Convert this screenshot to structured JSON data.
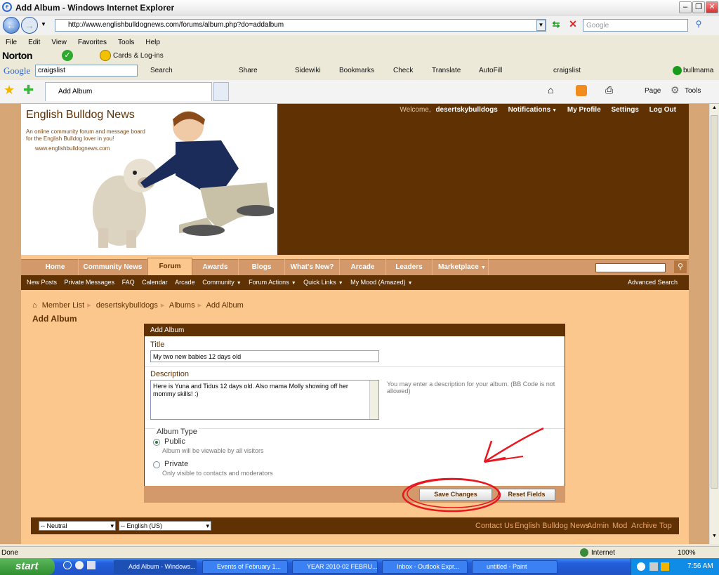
{
  "window": {
    "title": "Add Album - Windows Internet Explorer"
  },
  "browser": {
    "url": "http://www.englishbulldognews.com/forums/album.php?do=addalbum",
    "search_placeholder": "Google",
    "menu": [
      "File",
      "Edit",
      "View",
      "Favorites",
      "Tools",
      "Help"
    ],
    "norton": {
      "brand": "Norton",
      "cards_label": "Cards & Log-ins"
    },
    "google_toolbar": {
      "brand": "Google",
      "query": "craigslist",
      "items": [
        "Search",
        "Share",
        "Sidewiki",
        "Bookmarks",
        "Check",
        "Translate",
        "AutoFill",
        "craigslist"
      ],
      "user": "bullmama"
    },
    "tab_title": "Add Album",
    "cmd": {
      "page": "Page",
      "tools": "Tools"
    }
  },
  "site": {
    "title": "English Bulldog News",
    "tagline": "An online community forum and message board for the English Bulldog lover in you!",
    "url": "www.englishbulldognews.com",
    "welcome_label": "Welcome,",
    "username": "desertskybulldogs",
    "top_links": [
      "Notifications",
      "My Profile",
      "Settings",
      "Log Out"
    ],
    "nav_tabs": [
      "Home",
      "Community News",
      "Forum",
      "Awards",
      "Blogs",
      "What's New?",
      "Arcade",
      "Leaders",
      "Marketplace"
    ],
    "subnav": [
      "New Posts",
      "Private Messages",
      "FAQ",
      "Calendar",
      "Arcade",
      "Community",
      "Forum Actions",
      "Quick Links",
      "My Mood (Amazed)"
    ],
    "advanced_search": "Advanced Search"
  },
  "breadcrumb": [
    "Member List",
    "desertskybulldogs",
    "Albums",
    "Add Album"
  ],
  "page_title": "Add Album",
  "form": {
    "header": "Add Album",
    "title_label": "Title",
    "title_value": "My two new babies 12 days old",
    "description_label": "Description",
    "description_value": "Here is Yuna and Tidus 12 days old.  Also mama Molly showing off her mommy skills!  :)",
    "description_hint": "You may enter a description for your album. (BB Code is not allowed)",
    "album_type_label": "Album Type",
    "options": [
      {
        "label": "Public",
        "hint": "Album will be viewable by all visitors",
        "selected": true
      },
      {
        "label": "Private",
        "hint": "Only visible to contacts and moderators",
        "selected": false
      }
    ],
    "save_label": "Save Changes",
    "reset_label": "Reset Fields"
  },
  "footer": {
    "style_select": "-- Neutral",
    "lang_select": "-- English (US)",
    "links": [
      "Contact Us",
      "English Bulldog News",
      "Admin",
      "Mod",
      "Archive",
      "Top"
    ]
  },
  "status": {
    "left": "Done",
    "zone": "Internet",
    "zoom": "100%"
  },
  "taskbar": {
    "start": "start",
    "tasks": [
      "Add Album - Windows...",
      "Events of February 1...",
      "YEAR 2010-02 FEBRU...",
      "Inbox - Outlook Expr...",
      "untitled - Paint"
    ],
    "clock": "7:56 AM"
  },
  "colors": {
    "brown": "#5f3103",
    "peach": "#fbc78d",
    "tan": "#d3996a",
    "annotation": "#e8161e"
  }
}
